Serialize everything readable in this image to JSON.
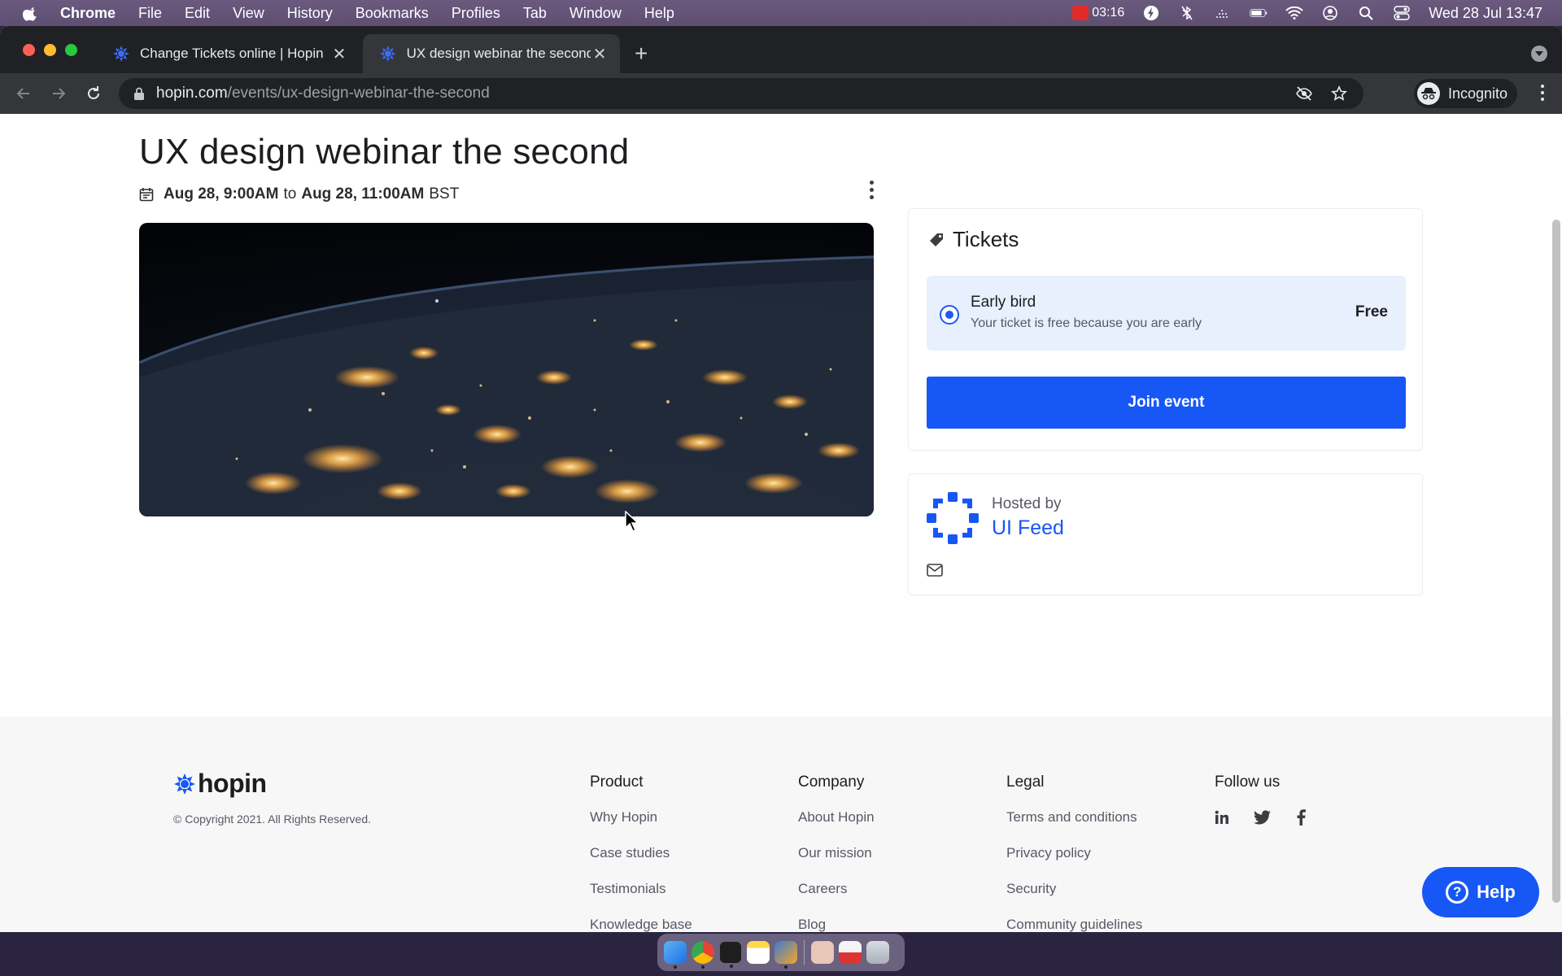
{
  "menubar": {
    "app_name": "Chrome",
    "items": [
      "File",
      "Edit",
      "View",
      "History",
      "Bookmarks",
      "Profiles",
      "Tab",
      "Window",
      "Help"
    ],
    "battery_timer": "03:16",
    "clock": "Wed 28 Jul  13:47"
  },
  "browser": {
    "tabs": [
      {
        "title": "Change Tickets online | Hopin"
      },
      {
        "title": "UX design webinar the second"
      }
    ],
    "url_host": "hopin.com",
    "url_path": "/events/ux-design-webinar-the-second",
    "profile_label": "Incognito"
  },
  "event": {
    "title": "UX design webinar the second",
    "start": "Aug 28, 9:00AM",
    "to_word": "to",
    "end": "Aug 28, 11:00AM",
    "timezone": "BST"
  },
  "tickets": {
    "heading": "Tickets",
    "options": [
      {
        "name": "Early bird",
        "description": "Your ticket is free because you are early",
        "price": "Free",
        "selected": true
      }
    ],
    "join_label": "Join event"
  },
  "host": {
    "hosted_by_label": "Hosted by",
    "name": "UI Feed"
  },
  "footer": {
    "logo_text": "hopin",
    "copyright": "© Copyright 2021. All Rights Reserved.",
    "columns": [
      {
        "heading": "Product",
        "links": [
          "Why Hopin",
          "Case studies",
          "Testimonials",
          "Knowledge base"
        ]
      },
      {
        "heading": "Company",
        "links": [
          "About Hopin",
          "Our mission",
          "Careers",
          "Blog"
        ]
      },
      {
        "heading": "Legal",
        "links": [
          "Terms and conditions",
          "Privacy policy",
          "Security",
          "Community guidelines"
        ]
      }
    ],
    "follow_heading": "Follow us",
    "social": [
      "linkedin-icon",
      "twitter-icon",
      "facebook-icon"
    ]
  },
  "help_widget": {
    "label": "Help"
  },
  "colors": {
    "accent": "#1757f5",
    "ticket_bg": "#e8effd"
  }
}
